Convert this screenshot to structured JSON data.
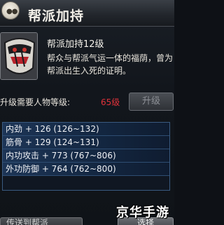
{
  "header": {
    "menu_icon": "menu-dots-icon",
    "title": "帮派加持"
  },
  "skill": {
    "icon": "mask-face-icon",
    "name": "帮派加持12级",
    "description": "帮众与帮派气运一体的福荫，曾为帮派出生入死的证明。"
  },
  "requirement": {
    "label": "升级需要人物等级:",
    "level": "65级",
    "level_color": "#e0323a",
    "upgrade_button": "升级"
  },
  "stats": [
    "内劲 + 126 (126~132)",
    "筋骨 + 129 (124~131)",
    "内功攻击 + 773 (767~806)",
    "外功防御 + 764 (762~800)"
  ],
  "bottom": {
    "left_button": "传送到帮派",
    "right_button": "选择"
  },
  "watermark": "京华手游"
}
